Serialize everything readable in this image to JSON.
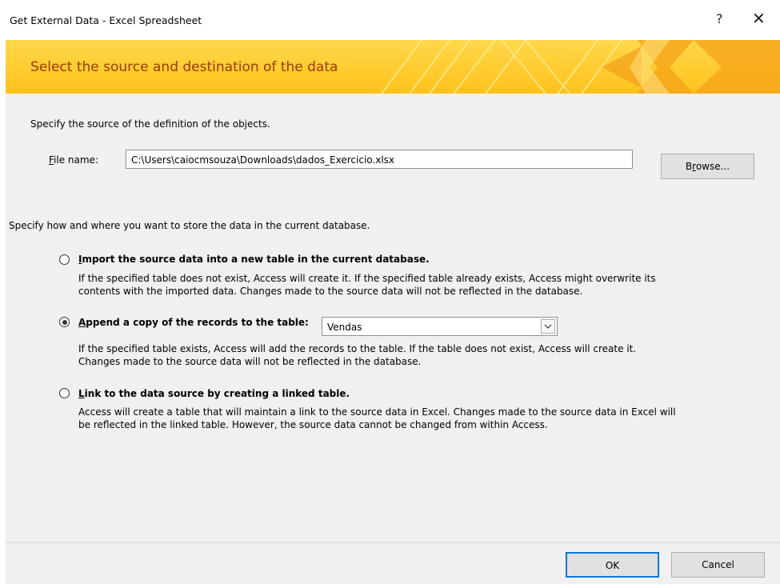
{
  "window": {
    "title": "Get External Data - Excel Spreadsheet",
    "help_label": "?",
    "close_label": "✕"
  },
  "banner": {
    "title": "Select the source and destination of the data"
  },
  "source": {
    "instruction": "Specify the source of the definition of the objects.",
    "file_label_first": "F",
    "file_label_rest": "ile name:",
    "file_value": "C:\\Users\\caiocmsouza\\Downloads\\dados_Exercicio.xlsx",
    "browse_pre": "B",
    "browse_u": "r",
    "browse_post": "owse..."
  },
  "storage": {
    "instruction": "Specify how and where you want to store the data in the current database.",
    "options": [
      {
        "u": "I",
        "label_rest": "mport the source data into a new table in the current database.",
        "selected": false,
        "desc1": "If the specified table does not exist, Access will create it. If the specified table already exists, Access might overwrite its",
        "desc2": "contents with the imported data. Changes made to the source data will not be reflected in the database."
      },
      {
        "u": "A",
        "label_rest": "ppend a copy of the records to the table:",
        "selected": true,
        "table_value": "Vendas",
        "desc1": "If the specified table exists, Access will add the records to the table. If the table does not exist, Access will create it.",
        "desc2": "Changes made to the source data will not be reflected in the database."
      },
      {
        "u": "L",
        "label_rest": "ink to the data source by creating a linked table.",
        "selected": false,
        "desc1": "Access will create a table that will maintain a link to the source data in Excel. Changes made to the source data in Excel will",
        "desc2": "be reflected in the linked table. However, the source data cannot be changed from within Access."
      }
    ]
  },
  "footer": {
    "ok_label": "OK",
    "cancel_label": "Cancel"
  },
  "colors": {
    "banner_top": "#ffd84a",
    "banner_bottom": "#ffc21b",
    "banner_text": "#9a3a06",
    "panel_bg": "#f0f0f0",
    "accent": "#0078d7"
  }
}
